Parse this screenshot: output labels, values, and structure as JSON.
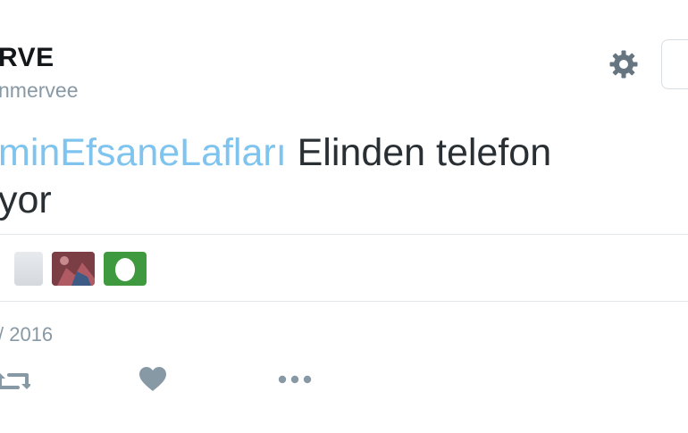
{
  "user": {
    "name": "RVE",
    "handle": "nmervee"
  },
  "tweet": {
    "hashtag": "minEfsaneLafları",
    "line1_text": " Elinden telefon",
    "line2_text": "yor"
  },
  "date": "/ 2016",
  "colors": {
    "hashtag": "#7fc4ef",
    "icon": "#8899a6",
    "gear": "#66757f",
    "avatar_green": "#3f9a3f"
  },
  "icons": {
    "settings": "gear-icon",
    "retweet": "retweet-icon",
    "like": "heart-icon",
    "more": "more-icon"
  }
}
